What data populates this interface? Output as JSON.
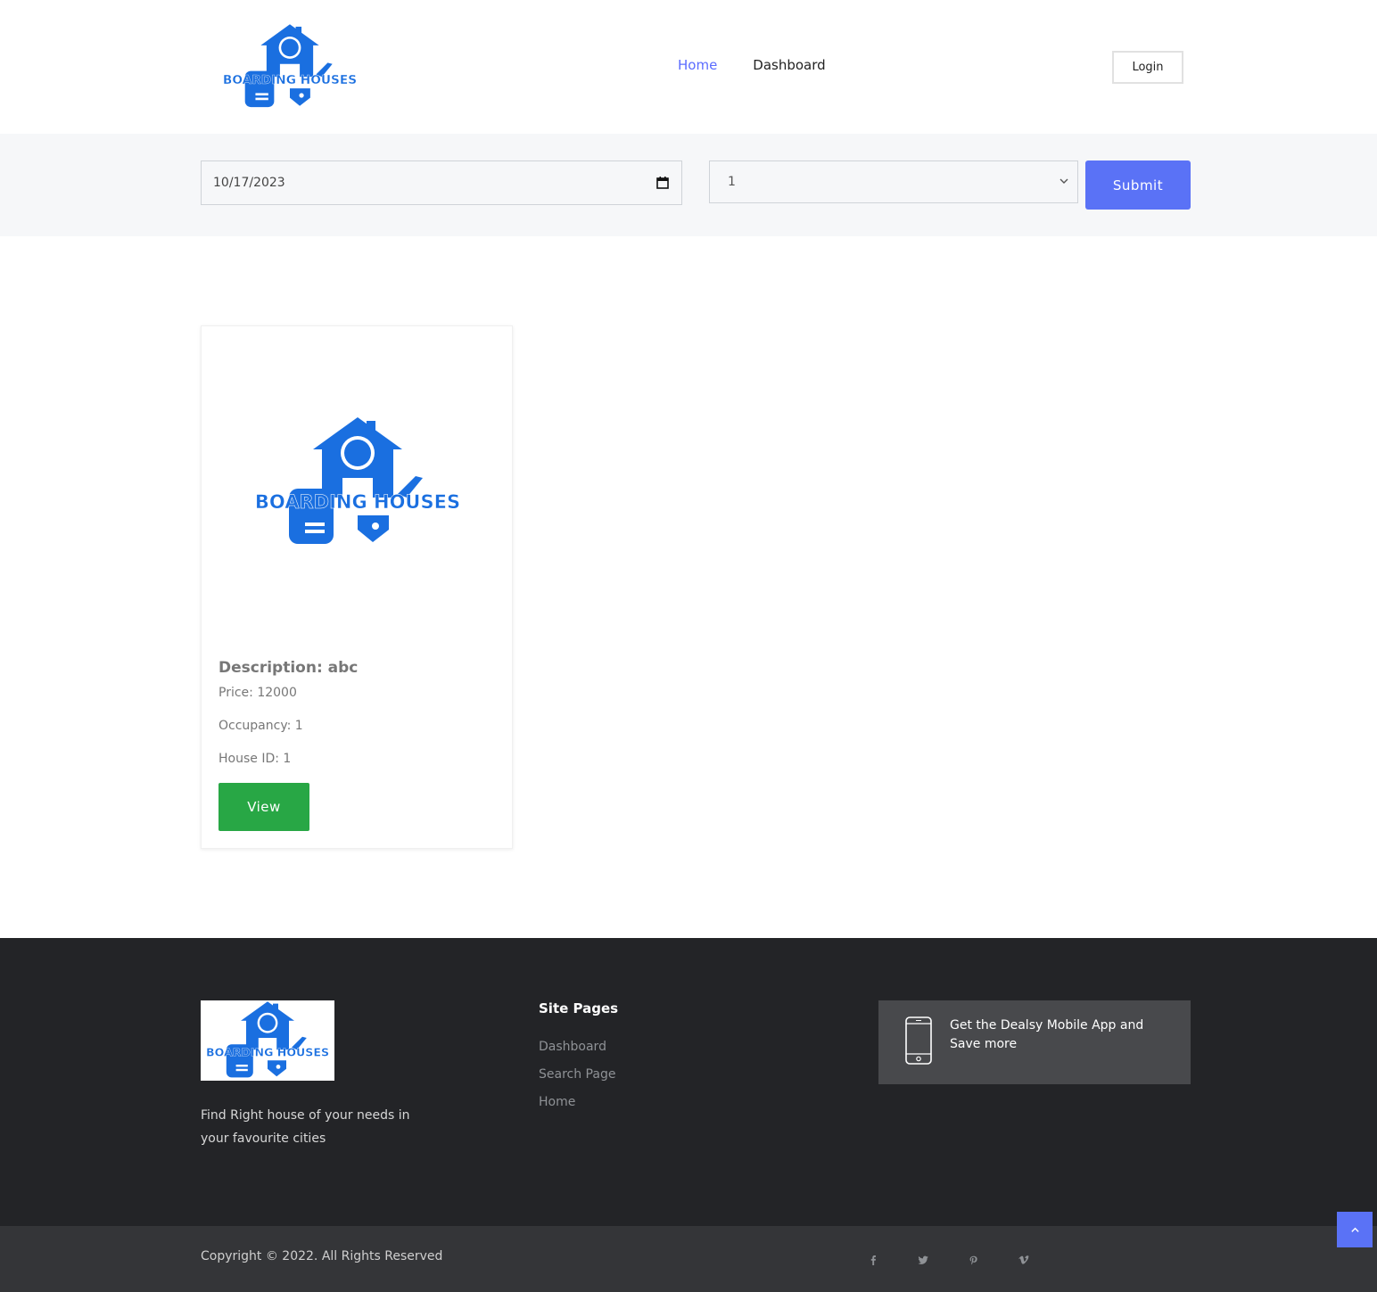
{
  "brand": {
    "logo_text": "BOARDING HOUSES",
    "logo_color": "#1a6fe0"
  },
  "nav": {
    "items": [
      {
        "label": "Home",
        "active": true
      },
      {
        "label": "Dashboard",
        "active": false
      }
    ],
    "login_label": "Login"
  },
  "search": {
    "date_value": "10/17/2023",
    "occupancy_value": "1",
    "submit_label": "Submit"
  },
  "listing": {
    "title": "Description: abc",
    "price": "Price: 12000",
    "occupancy": "Occupancy: 1",
    "house_id": "House ID: 1",
    "view_label": "View"
  },
  "footer": {
    "tagline": "Find Right house of your needs in your favourite cities",
    "site_pages_heading": "Site Pages",
    "site_pages": [
      "Dashboard",
      "Search Page",
      "Home"
    ],
    "app_promo": "Get the Dealsy Mobile App and Save more",
    "copyright": "Copyright © 2022. All Rights Reserved",
    "socials": [
      "facebook-icon",
      "twitter-icon",
      "pinterest-icon",
      "vimeo-icon"
    ]
  },
  "colors": {
    "accent": "#5a72f6",
    "success": "#28a745",
    "footer_bg": "#232427"
  }
}
